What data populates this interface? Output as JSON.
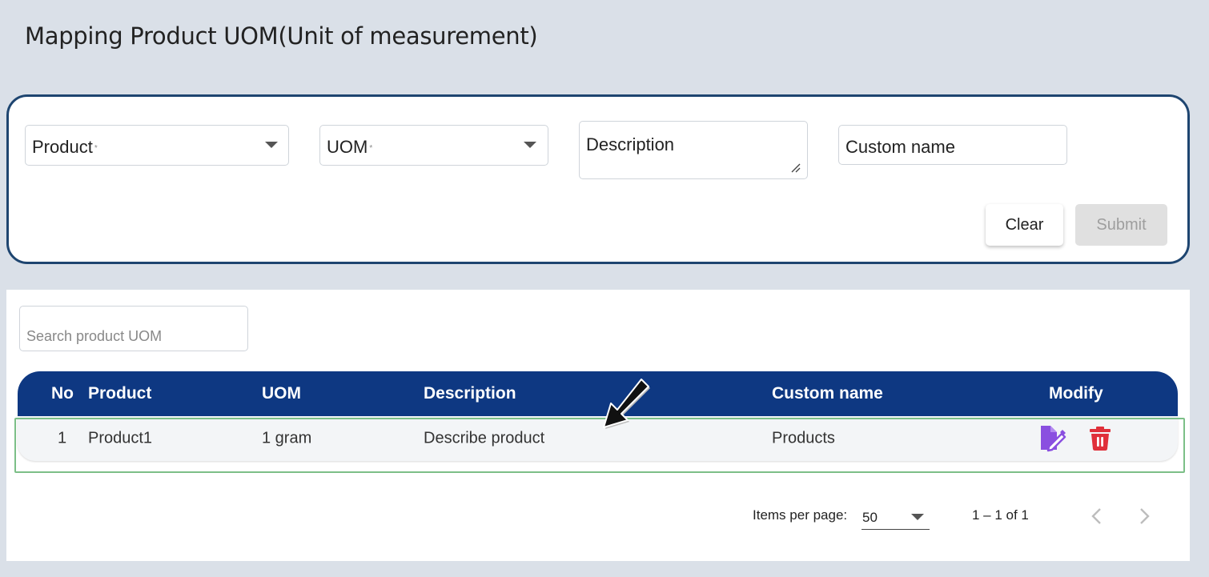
{
  "page": {
    "title": "Mapping Product UOM(Unit of measurement)"
  },
  "form": {
    "product": {
      "label": "Product",
      "required_mark": "*"
    },
    "uom": {
      "label": "UOM",
      "required_mark": "*"
    },
    "description": {
      "placeholder": "Description"
    },
    "custom_name": {
      "placeholder": "Custom name"
    },
    "clear_label": "Clear",
    "submit_label": "Submit"
  },
  "search": {
    "placeholder": "Search product UOM"
  },
  "table": {
    "columns": {
      "no": "No",
      "product": "Product",
      "uom": "UOM",
      "description": "Description",
      "custom_name": "Custom name",
      "modify": "Modify"
    },
    "rows": [
      {
        "no": "1",
        "product": "Product1",
        "uom": "1 gram",
        "description": "Describe product",
        "custom_name": "Products"
      }
    ]
  },
  "pagination": {
    "items_per_page_label": "Items per page:",
    "items_per_page_value": "50",
    "range": "1 – 1 of 1"
  },
  "colors": {
    "header_bg": "#0e3882",
    "card_border": "#1e4570",
    "edit_icon": "#8a4fe0",
    "delete_icon": "#e0303a",
    "row_highlight": "#7cbf87"
  },
  "icons": [
    "edit-icon",
    "delete-icon",
    "chevron-left-icon",
    "chevron-right-icon",
    "dropdown-caret-icon"
  ]
}
